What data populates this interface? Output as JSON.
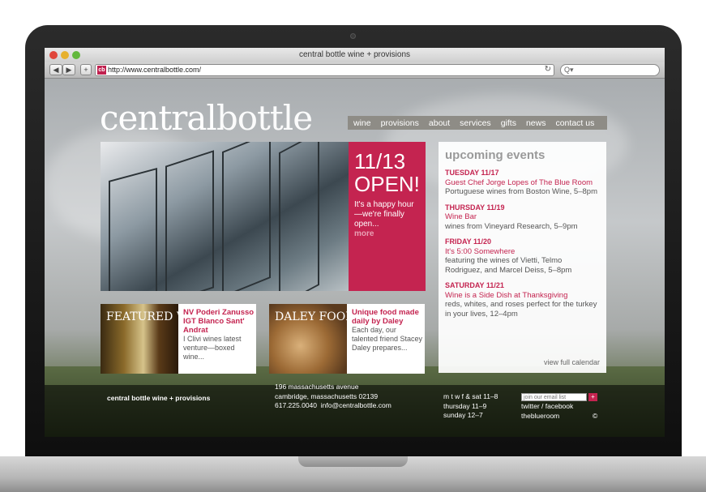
{
  "browser": {
    "window_title": "central bottle wine + provisions",
    "url": "http://www.centralbottle.com/",
    "favicon_text": "cb",
    "back": "◀",
    "forward": "▶",
    "add": "+",
    "reload": "↻",
    "search_glyph": "Q▾"
  },
  "site": {
    "logo_light": "central",
    "logo_bold": "bottle",
    "nav": [
      "wine",
      "provisions",
      "about",
      "services",
      "gifts",
      "news",
      "contact us"
    ],
    "hero": {
      "headline_line1": "11/13",
      "headline_line2": "OPEN!",
      "text": "It's a happy hour—we're finally open...",
      "more": "more"
    },
    "events": {
      "heading": "upcoming events",
      "items": [
        {
          "date": "TUESDAY 11/17",
          "title": "Guest Chef Jorge Lopes of The Blue Room",
          "detail": "Portuguese wines from Boston Wine, 5–8pm"
        },
        {
          "date": "THURSDAY 11/19",
          "title": "Wine Bar",
          "detail": "wines from Vineyard Research, 5–9pm"
        },
        {
          "date": "FRIDAY 11/20",
          "title": "It's 5:00 Somewhere",
          "detail": "featuring the wines of Vietti, Telmo Rodriguez, and Marcel Deiss, 5–8pm"
        },
        {
          "date": "SATURDAY 11/21",
          "title": "Wine is a Side Dish at Thanksgiving",
          "detail": "reds, whites, and roses perfect for the turkey in your lives, 12–4pm"
        }
      ],
      "view_all": "view full calendar"
    },
    "cards": [
      {
        "caption": "FEATURED WINE",
        "title": "NV Poderi Zanusso IGT Blanco Sant' Andrat",
        "body": "I Clivi wines latest venture—boxed wine..."
      },
      {
        "caption": "DALEY FOOD",
        "title": "Unique food made daily by Daley",
        "body": "Each day, our talented friend Stacey Daley prepares..."
      }
    ],
    "footer": {
      "name": "central bottle wine + provisions",
      "address1": "196 massachusetts avenue",
      "address2": "cambridge, massachusetts 02139",
      "phone": "617.225.0040",
      "email": "info@centralbottle.com",
      "hours1": "m t w f & sat 11–8",
      "hours2": "thursday 11–9",
      "hours3": "sunday 12–7",
      "email_placeholder": "join our email list",
      "email_button": "+",
      "social": "twitter / facebook",
      "partner": "theblueroom",
      "copyright": "©"
    }
  }
}
